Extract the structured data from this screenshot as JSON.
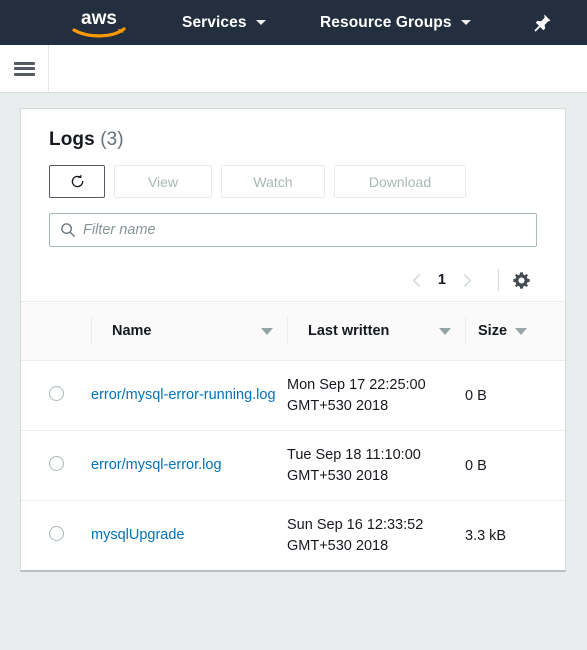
{
  "topnav": {
    "logo_text": "aws",
    "logo_icon": "aws-logo-icon",
    "services_label": "Services",
    "resource_groups_label": "Resource Groups",
    "pin_icon": "pushpin-icon",
    "bg_color": "#232f3e"
  },
  "subbar": {
    "menu_icon": "hamburger-menu-icon"
  },
  "panel": {
    "title": "Logs",
    "count": "(3)",
    "buttons": {
      "refresh_icon": "refresh-icon",
      "view_label": "View",
      "watch_label": "Watch",
      "download_label": "Download"
    },
    "filter": {
      "placeholder": "Filter name",
      "value": "",
      "icon": "search-icon"
    },
    "pagination": {
      "prev_icon": "chevron-left-icon",
      "page": "1",
      "next_icon": "chevron-right-icon",
      "settings_icon": "gear-icon"
    }
  },
  "table": {
    "columns": [
      {
        "label": "Name",
        "sort_icon": "sort-descending-triangle-icon"
      },
      {
        "label": "Last written",
        "sort_icon": "sort-descending-triangle-icon"
      },
      {
        "label": "Size",
        "sort_icon": "sort-descending-triangle-icon"
      }
    ],
    "rows": [
      {
        "name": "error/mysql-error-running.log",
        "last_written": "Mon Sep 17 22:25:00 GMT+530 2018",
        "size": "0 B"
      },
      {
        "name": "error/mysql-error.log",
        "last_written": "Tue Sep 18 11:10:00 GMT+530 2018",
        "size": "0 B"
      },
      {
        "name": "mysqlUpgrade",
        "last_written": "Sun Sep 16 12:33:52 GMT+530 2018",
        "size": "3.3 kB"
      }
    ]
  },
  "colors": {
    "link": "#0073bb",
    "nav_bg": "#232f3e",
    "logo_swoosh": "#ff9900",
    "page_bg": "#eaeded"
  }
}
